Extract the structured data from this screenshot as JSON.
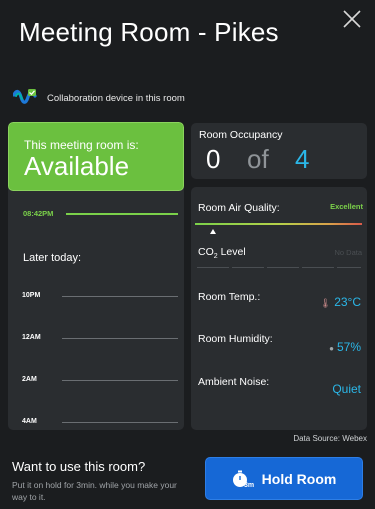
{
  "header": {
    "title": "Meeting Room - Pikes",
    "collab_label": "Collaboration device in this room"
  },
  "status": {
    "label": "This meeting room is:",
    "value": "Available",
    "color": "#6bc03f"
  },
  "schedule": {
    "now_time": "08:42PM",
    "later_label": "Later today:",
    "slots": [
      "10PM",
      "12AM",
      "2AM",
      "4AM"
    ]
  },
  "occupancy": {
    "label": "Room Occupancy",
    "count": "0",
    "of": "of",
    "capacity": "4"
  },
  "environment": {
    "air_quality": {
      "label": "Room Air Quality:",
      "value": "Excellent"
    },
    "co2": {
      "label_prefix": "CO",
      "label_sub": "2",
      "label_suffix": " Level",
      "value": "No Data"
    },
    "temperature": {
      "label": "Room Temp.:",
      "value": "23°C"
    },
    "humidity": {
      "label": "Room Humidity:",
      "value": "57%"
    },
    "noise": {
      "label": "Ambient Noise:",
      "value": "Quiet"
    }
  },
  "footer": {
    "source": "Data Source: Webex",
    "cta_title": "Want to use this room?",
    "cta_desc": "Put it on hold for 3min. while you make your way to it.",
    "hold_button": "Hold Room",
    "hold_icon_badge": "3m"
  },
  "colors": {
    "accent_blue": "#1668d6",
    "value_blue": "#2bb7e8",
    "green": "#7bd14a",
    "panel": "#2a2d30",
    "background": "#1b1d1f"
  },
  "icons": [
    "close-icon",
    "webex-icon",
    "temperature-icon",
    "droplet-icon",
    "timer-icon"
  ]
}
